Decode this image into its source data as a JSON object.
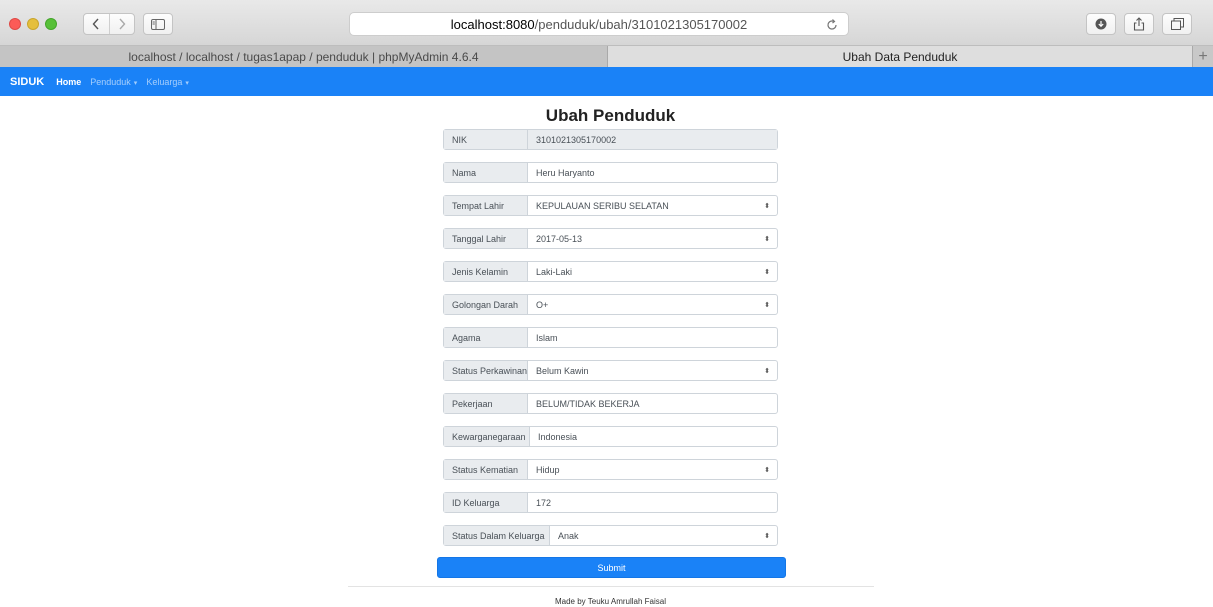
{
  "browser": {
    "url_host": "localhost:8080",
    "url_path": "/penduduk/ubah/3101021305170002",
    "tabs": [
      {
        "label": "localhost / localhost / tugas1apap / penduduk | phpMyAdmin 4.6.4",
        "active": false
      },
      {
        "label": "Ubah Data Penduduk",
        "active": true
      }
    ],
    "new_tab_label": "+"
  },
  "navbar": {
    "brand": "SIDUK",
    "home": "Home",
    "penduduk": "Penduduk",
    "keluarga": "Keluarga",
    "caret": "▾"
  },
  "form": {
    "title": "Ubah Penduduk",
    "fields": [
      {
        "label": "NIK",
        "value": "3101021305170002",
        "type": "readonly"
      },
      {
        "label": "Nama",
        "value": "Heru Haryanto",
        "type": "text"
      },
      {
        "label": "Tempat Lahir",
        "value": "KEPULAUAN SERIBU SELATAN",
        "type": "select"
      },
      {
        "label": "Tanggal Lahir",
        "value": "2017-05-13",
        "type": "select"
      },
      {
        "label": "Jenis Kelamin",
        "value": "Laki-Laki",
        "type": "select"
      },
      {
        "label": "Golongan Darah",
        "value": "O+",
        "type": "select"
      },
      {
        "label": "Agama",
        "value": "Islam",
        "type": "text"
      },
      {
        "label": "Status Perkawinan",
        "value": "Belum Kawin",
        "type": "select"
      },
      {
        "label": "Pekerjaan",
        "value": "BELUM/TIDAK BEKERJA",
        "type": "text"
      },
      {
        "label": "Kewarganegaraan",
        "value": "Indonesia",
        "type": "text"
      },
      {
        "label": "Status Kematian",
        "value": "Hidup",
        "type": "select"
      },
      {
        "label": "ID Keluarga",
        "value": "172",
        "type": "text"
      },
      {
        "label": "Status Dalam Keluarga",
        "value": "Anak",
        "type": "select"
      }
    ],
    "select_arrow": "⬍",
    "submit_label": "Submit"
  },
  "footer": {
    "text": "Made by Teuku Amrullah Faisal"
  }
}
